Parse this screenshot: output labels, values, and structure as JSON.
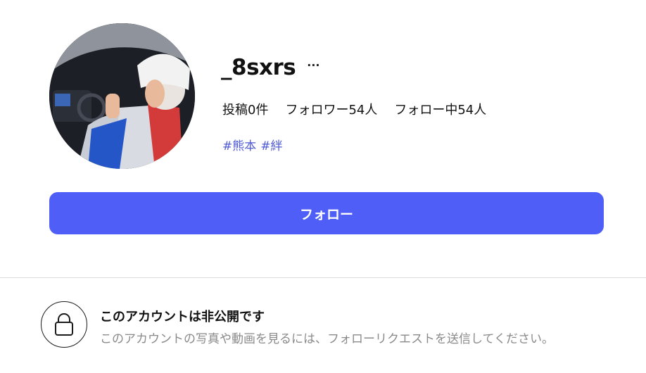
{
  "profile": {
    "username": "_8sxrs",
    "more_label": "···",
    "avatar_icon": "profile-photo"
  },
  "stats": {
    "posts": "投稿0件",
    "followers": "フォロワー54人",
    "following": "フォロー中54人"
  },
  "bio": {
    "tags": [
      "#熊本",
      "#絆"
    ]
  },
  "actions": {
    "follow_label": "フォロー"
  },
  "private_notice": {
    "icon": "lock-icon",
    "title": "このアカウントは非公開です",
    "description": "このアカウントの写真や動画を見るには、フォローリクエストを送信してください。"
  },
  "colors": {
    "accent": "#4f5ef7",
    "tag": "#4f5bd5",
    "muted_text": "#8a8a8a"
  }
}
